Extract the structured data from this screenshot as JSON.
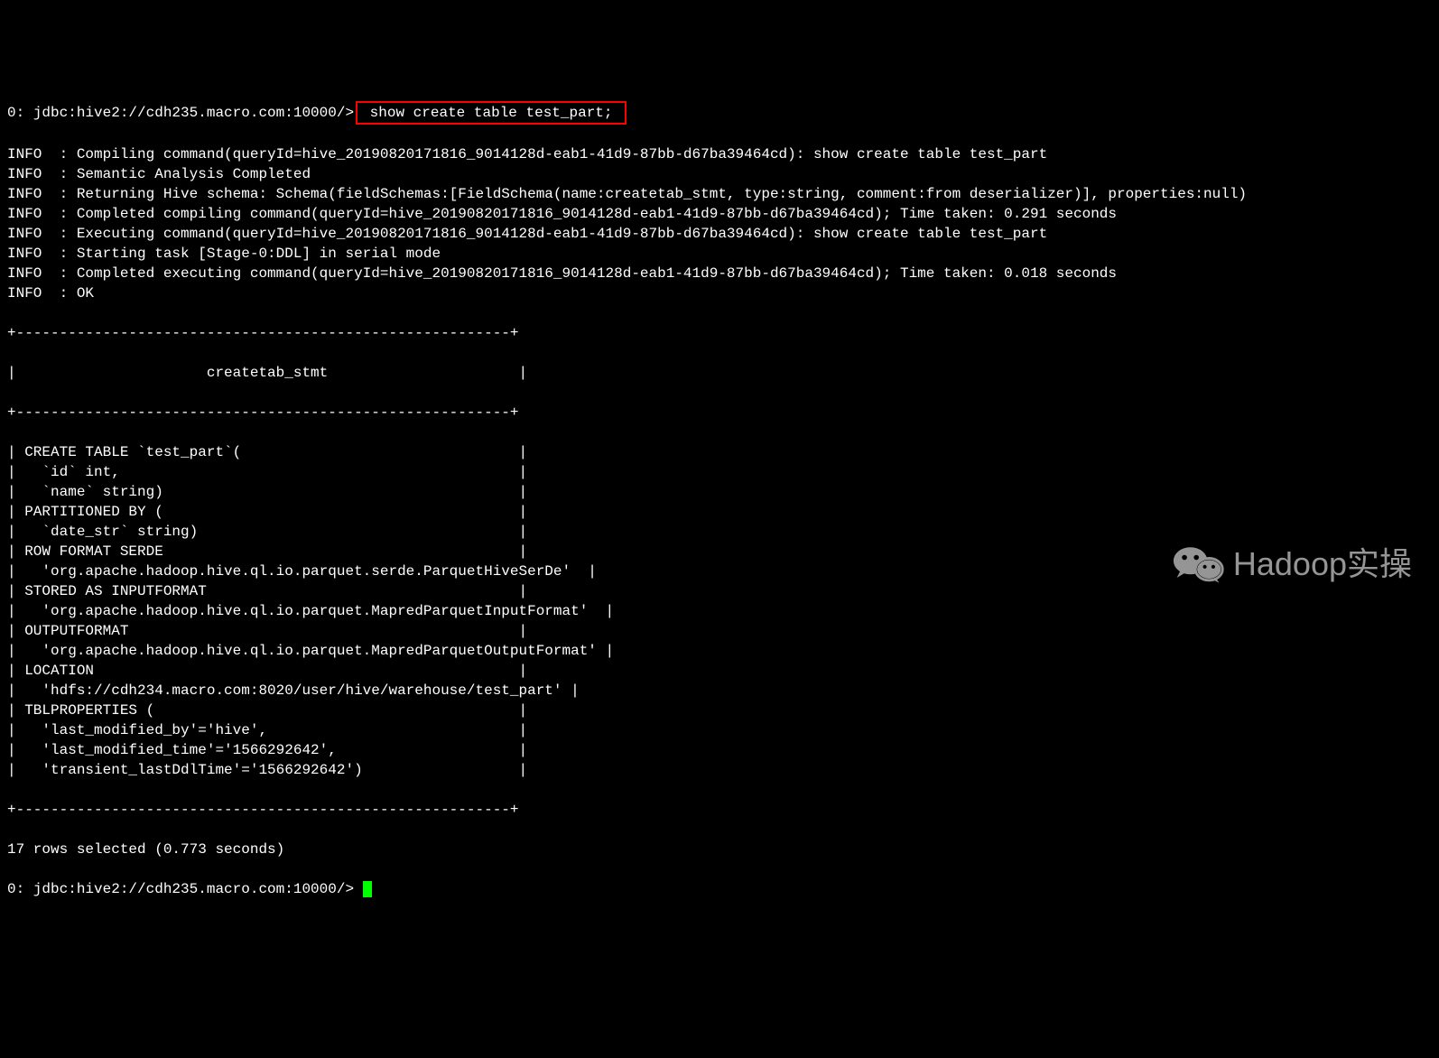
{
  "prompt1_prefix": "0: jdbc:hive2://cdh235.macro.com:10000/>",
  "prompt1_cmd": " show create table test_part; ",
  "log_lines": [
    "INFO  : Compiling command(queryId=hive_20190820171816_9014128d-eab1-41d9-87bb-d67ba39464cd): show create table test_part",
    "INFO  : Semantic Analysis Completed",
    "INFO  : Returning Hive schema: Schema(fieldSchemas:[FieldSchema(name:createtab_stmt, type:string, comment:from deserializer)], properties:null)",
    "INFO  : Completed compiling command(queryId=hive_20190820171816_9014128d-eab1-41d9-87bb-d67ba39464cd); Time taken: 0.291 seconds",
    "INFO  : Executing command(queryId=hive_20190820171816_9014128d-eab1-41d9-87bb-d67ba39464cd): show create table test_part",
    "INFO  : Starting task [Stage-0:DDL] in serial mode",
    "INFO  : Completed executing command(queryId=hive_20190820171816_9014128d-eab1-41d9-87bb-d67ba39464cd); Time taken: 0.018 seconds",
    "INFO  : OK"
  ],
  "table_border": "+---------------------------------------------------------+",
  "table_header": "|                      createtab_stmt                      |",
  "table_rows": [
    "| CREATE TABLE `test_part`(                                |",
    "|   `id` int,                                              |",
    "|   `name` string)                                         |",
    "| PARTITIONED BY (                                         |",
    "|   `date_str` string)                                     |",
    "| ROW FORMAT SERDE                                         |",
    "|   'org.apache.hadoop.hive.ql.io.parquet.serde.ParquetHiveSerDe'  |",
    "| STORED AS INPUTFORMAT                                    |",
    "|   'org.apache.hadoop.hive.ql.io.parquet.MapredParquetInputFormat'  |",
    "| OUTPUTFORMAT                                             |",
    "|   'org.apache.hadoop.hive.ql.io.parquet.MapredParquetOutputFormat' |",
    "| LOCATION                                                 |",
    "|   'hdfs://cdh234.macro.com:8020/user/hive/warehouse/test_part' |",
    "| TBLPROPERTIES (                                          |",
    "|   'last_modified_by'='hive',                             |",
    "|   'last_modified_time'='1566292642',                     |",
    "|   'transient_lastDdlTime'='1566292642')                  |"
  ],
  "footer": "17 rows selected (0.773 seconds)",
  "prompt2": "0: jdbc:hive2://cdh235.macro.com:10000/> ",
  "watermark_text": "Hadoop实操"
}
